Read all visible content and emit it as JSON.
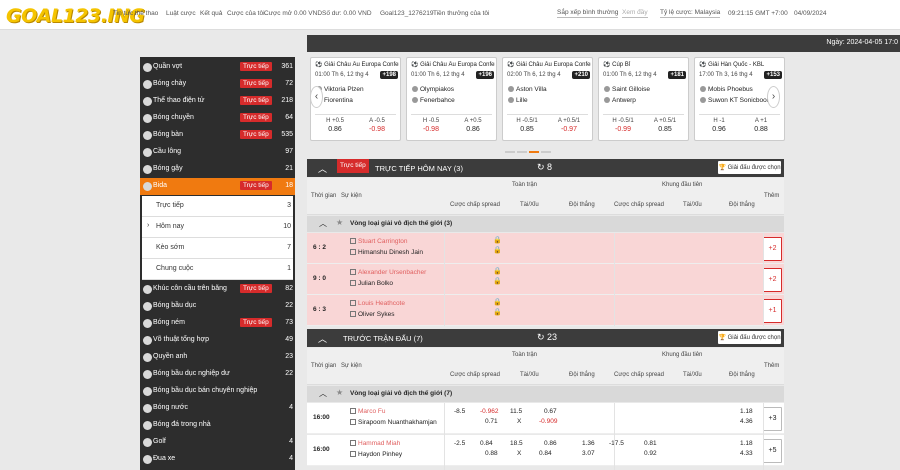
{
  "header": {
    "logo": "GOAL123.ING",
    "nav": [
      "Tin tức thể thao",
      "Luật cược",
      "Kết quả",
      "Cược của tôi",
      "Cược mở 0.00 VND",
      "Số dư: 0.00 VND",
      "Goal123_1276219",
      "Tiền thưởng của tôi"
    ],
    "sort": "Sắp xếp bình thường",
    "odds_type": "Tỷ lệ cược: Malaysia",
    "clock": "09:21:15 GMT +7:00",
    "date": "04/09/2024",
    "search_placeholder": "Xem đầy"
  },
  "datebar": {
    "label": "Ngày: 2024-04-05 17:0"
  },
  "sidebar": {
    "items": [
      {
        "label": "Quần vợt",
        "live": "Trực tiếp",
        "count": "361",
        "icon": "tennis-ball-icon"
      },
      {
        "label": "Bóng chày",
        "live": "Trực tiếp",
        "count": "72",
        "icon": "baseball-icon"
      },
      {
        "label": "Thể thao điện tử",
        "live": "Trực tiếp",
        "count": "218",
        "icon": "esports-icon"
      },
      {
        "label": "Bóng chuyền",
        "live": "Trực tiếp",
        "count": "64",
        "icon": "volleyball-icon"
      },
      {
        "label": "Bóng bàn",
        "live": "Trực tiếp",
        "count": "535",
        "icon": "table-tennis-icon"
      },
      {
        "label": "Cầu lông",
        "live": "",
        "count": "97",
        "icon": "badminton-icon"
      },
      {
        "label": "Bóng gậy",
        "live": "",
        "count": "21",
        "icon": "cricket-icon"
      },
      {
        "label": "Bida",
        "live": "Trực tiếp",
        "count": "18",
        "icon": "billiards-icon",
        "active": true
      }
    ],
    "sub": [
      {
        "label": "Trực tiếp",
        "count": "3",
        "chev": ""
      },
      {
        "label": "Hôm nay",
        "count": "10",
        "chev": "›"
      },
      {
        "label": "Kèo sớm",
        "count": "7",
        "chev": ""
      },
      {
        "label": "Chung cuộc",
        "count": "1",
        "chev": ""
      }
    ],
    "items2": [
      {
        "label": "Khúc côn cầu trên băng",
        "live": "Trực tiếp",
        "count": "82",
        "icon": "ice-hockey-icon"
      },
      {
        "label": "Bóng bầu dục",
        "live": "",
        "count": "22",
        "icon": "rugby-icon"
      },
      {
        "label": "Bóng ném",
        "live": "Trực tiếp",
        "count": "73",
        "icon": "handball-icon"
      },
      {
        "label": "Võ thuật tổng hợp",
        "live": "",
        "count": "49",
        "icon": "mma-icon"
      },
      {
        "label": "Quyền anh",
        "live": "",
        "count": "23",
        "icon": "boxing-icon"
      },
      {
        "label": "Bóng bầu dục nghiệp dư",
        "live": "",
        "count": "22",
        "icon": "rugby-union-icon"
      },
      {
        "label": "Bóng bầu dục bán chuyên nghiệp",
        "live": "",
        "count": "",
        "icon": "rugby-league-icon"
      },
      {
        "label": "Bóng nước",
        "live": "",
        "count": "4",
        "icon": "water-polo-icon"
      },
      {
        "label": "Bóng đá trong nhà",
        "live": "",
        "count": "",
        "icon": "futsal-icon"
      },
      {
        "label": "Golf",
        "live": "",
        "count": "4",
        "icon": "golf-icon"
      },
      {
        "label": "Đua xe",
        "live": "",
        "count": "4",
        "icon": "racing-icon"
      }
    ]
  },
  "cards": [
    {
      "comp": "⚽ Giải Châu Âu Europa Confer...",
      "time": "01:00 Th 6, 12 thg 4",
      "badge": "+198",
      "t1": "Viktoria Plzen",
      "t2": "Fiorentina",
      "o": [
        [
          "H",
          "+0.5",
          "0.86"
        ],
        [
          "A",
          "-0.5",
          "-0.98"
        ]
      ]
    },
    {
      "comp": "⚽ Giải Châu Âu Europa Confer...",
      "time": "01:00 Th 6, 12 thg 4",
      "badge": "+196",
      "t1": "Olympiakos",
      "t2": "Fenerbahce",
      "o": [
        [
          "H",
          "-0.5",
          "-0.98"
        ],
        [
          "A",
          "+0.5",
          "0.86"
        ]
      ]
    },
    {
      "comp": "⚽ Giải Châu Âu Europa Confer...",
      "time": "02:00 Th 6, 12 thg 4",
      "badge": "+210",
      "t1": "Aston Villa",
      "t2": "Lille",
      "o": [
        [
          "H",
          "-0.5/1",
          "0.85"
        ],
        [
          "A",
          "+0.5/1",
          "-0.97"
        ]
      ]
    },
    {
      "comp": "⚽ Cúp Bỉ",
      "time": "01:00 Th 6, 12 thg 4",
      "badge": "+181",
      "t1": "Saint Gilloise",
      "t2": "Antwerp",
      "o": [
        [
          "H",
          "-0.5/1",
          "-0.99"
        ],
        [
          "A",
          "+0.5/1",
          "0.85"
        ]
      ]
    },
    {
      "comp": "⚽ Giải Hàn Quốc - KBL",
      "time": "17:00 Th 3, 16 thg 4",
      "badge": "+153",
      "t1": "Mobis Phoebus",
      "t2": "Suwon KT Sonicboom",
      "o": [
        [
          "H",
          "-1",
          "0.96"
        ],
        [
          "A",
          "+1",
          "0.88"
        ]
      ]
    }
  ],
  "live_section": {
    "live_tag": "Trực tiếp",
    "title": "TRỰC TIẾP HÔM NAY (3)",
    "count": "8",
    "fav": "Giải đấu được chọn"
  },
  "pre_section": {
    "title": "TRƯỚC TRẬN ĐẤU (7)",
    "count": "23",
    "fav": "Giải đấu được chọn"
  },
  "columns": {
    "time": "Thời gian",
    "event": "Sự kiện",
    "full": "Toàn trận",
    "half": "Khung đầu tiên",
    "hdp": "Cược chấp spread",
    "ou": "Tài/Xỉu",
    "winner": "Đội thắng",
    "more": "Thêm"
  },
  "league": "Vòng loại giải vô địch thế giới (3)",
  "league2": "Vòng loại giải vô địch thế giới (7)",
  "live_matches": [
    {
      "score": "6 : 2",
      "t1": "Stuart Carrington",
      "t2": "Himanshu Dinesh Jain",
      "more": "+2"
    },
    {
      "score": "9 : 0",
      "t1": "Alexander Ursenbacher",
      "t2": "Julian Bolko",
      "more": "+2"
    },
    {
      "score": "6 : 3",
      "t1": "Louis Heathcote",
      "t2": "Oliver Sykes",
      "more": "+1"
    }
  ],
  "pre_matches": [
    {
      "time": "16:00",
      "t1": "Marco Fu",
      "t2": "Sirapoom Nuanthakhamjan",
      "h": "-8.5",
      "ho": "-0.962",
      "ho2": "0.71",
      "ou": "11.5",
      "ou2": "X",
      "ouo": "0.67",
      "ouo2": "-0.909",
      "w1": "",
      "w2": "",
      "hh": "",
      "hh2": "",
      "ho3": "",
      "wh1": "1.18",
      "wh2": "4.36",
      "more": "+3"
    },
    {
      "time": "16:00",
      "t1": "Hammad Miah",
      "t2": "Haydon Pinhey",
      "h": "-2.5",
      "ho": "0.84",
      "ho2": "0.88",
      "ou": "18.5",
      "ou2": "X",
      "ouo": "0.86",
      "ouo2": "0.84",
      "w1": "1.36",
      "w2": "3.07",
      "hh": "-17.5",
      "ho3": "0.81",
      "hh2": "0.92",
      "wh1": "1.18",
      "wh2": "4.33",
      "more": "+5"
    }
  ]
}
